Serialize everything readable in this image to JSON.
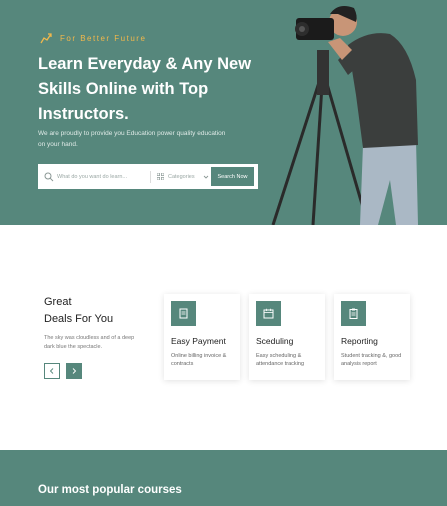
{
  "hero": {
    "tagline": "For Better Future",
    "title": "Learn Everyday & Any New Skills Online with Top Instructors.",
    "description": "We are proudly to provide you Education power quality education on your hand.",
    "search": {
      "placeholder": "What do you want do learn...",
      "category_label": "Categories",
      "button_label": "Search Now"
    }
  },
  "deals": {
    "title_line1": "Great",
    "title_line2": "Deals For You",
    "description": "The sky was cloudless and of a deep dark blue the spectacle."
  },
  "features": [
    {
      "title": "Easy Payment",
      "description": "Online billing invoice & contracts",
      "icon": "invoice-icon"
    },
    {
      "title": "Sceduling",
      "description": "Easy scheduling & attendance tracking",
      "icon": "calendar-icon"
    },
    {
      "title": "Reporting",
      "description": "Student tracking &, good analysis report",
      "icon": "clipboard-icon"
    }
  ],
  "popular": {
    "title": "Our most popular courses"
  },
  "colors": {
    "primary": "#56877c",
    "accent": "#f2b84b"
  }
}
